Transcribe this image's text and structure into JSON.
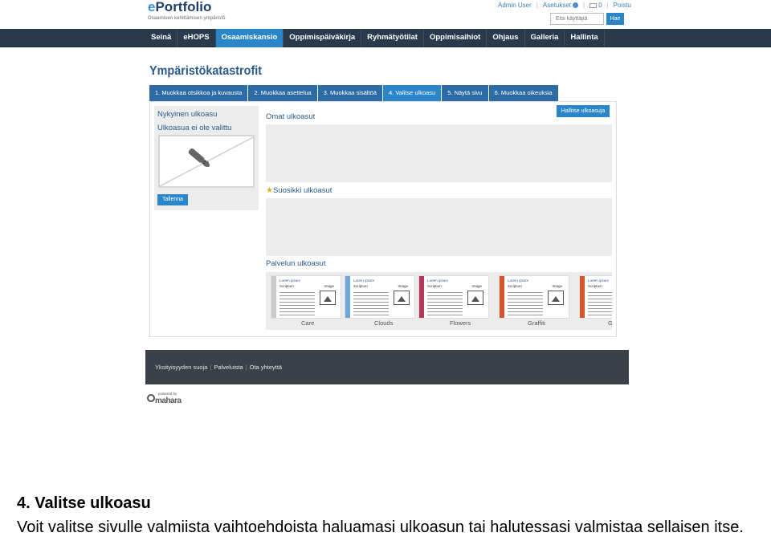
{
  "header": {
    "brand_e": "e",
    "brand_rest": "Portfolio",
    "tagline": "Osaamisen kehittämisen ympäristö",
    "user_link": "Admin User",
    "settings_link": "Asetukset",
    "messages_count": "0",
    "logout_link": "Poistu",
    "search_placeholder": "Etsi käyttäjiä",
    "search_button": "Hae"
  },
  "nav": {
    "items": [
      "Seinä",
      "eHOPS",
      "Osaamiskansio",
      "Oppimispäiväkirja",
      "Ryhmätyötilat",
      "Oppimisaihiot",
      "Ohjaus",
      "Galleria",
      "Hallinta"
    ],
    "active_index": 2
  },
  "main": {
    "title": "Ympäristökatastrofit",
    "steps": [
      "1. Muokkaa otsikkoa ja kuvausta",
      "2. Muokkaa asettelua",
      "3. Muokkaa sisältöä",
      "4. Valitse ulkoasu",
      "5. Näytä sivu",
      "6. Muokkaa oikeuksia"
    ],
    "active_step": 3,
    "current_theme_heading": "Nykyinen ulkoasu",
    "current_theme_value": "Ulkoasua ei ole valittu",
    "save_button": "Tallenna",
    "own_themes_heading": "Omat ulkoasut",
    "manage_button": "Hallitse ulkoasuja",
    "favorite_heading": "Suosikki ulkoasut",
    "service_heading": "Palvelun ulkoasut",
    "themes": [
      {
        "name": "Care",
        "title": "Lorem ipsum",
        "col1": "Scriptum",
        "col2": "Image",
        "color": "#c9c9c9"
      },
      {
        "name": "Clouds",
        "title": "Lorem ipsum",
        "col1": "Scriptum",
        "col2": "Image",
        "color": "#6da7d8"
      },
      {
        "name": "Flowers",
        "title": "Lorem ipsum",
        "col1": "Scriptum",
        "col2": "Image",
        "color": "#b2375b"
      },
      {
        "name": "Graffiti",
        "title": "Lorem ipsum",
        "col1": "Scriptum",
        "col2": "Image",
        "color": "#d3562a"
      },
      {
        "name": "G",
        "title": "Lorem ipsum",
        "col1": "Scriptum",
        "col2": "",
        "color": "#d3562a"
      }
    ]
  },
  "footer": {
    "links": [
      "Yksityisyyden suoja",
      "Palveluista",
      "Ota yhteyttä"
    ],
    "powered_by": "powered by",
    "mahara": "mahara"
  },
  "caption": {
    "title": "4. Valitse ulkoasu",
    "body": "Voit valitse sivulle valmiista vaihtoehdoista haluamasi ulkoasun tai halutessasi valmistaa sellaisen itse."
  }
}
